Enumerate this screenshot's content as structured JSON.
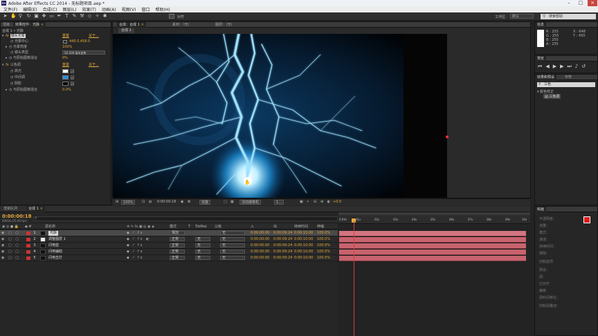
{
  "title_bar": {
    "app": "Adobe After Effects CC 2014 - 无标题项目.aep *"
  },
  "menu": [
    "文件(F)",
    "编辑(E)",
    "合成(C)",
    "图层(L)",
    "效果(T)",
    "动画(A)",
    "视图(V)",
    "窗口",
    "帮助(H)"
  ],
  "toolbar": {
    "align_label": "对齐",
    "workspace_label": "工作区:",
    "workspace_value": "默认",
    "search_placeholder": "搜索帮助"
  },
  "project_panel": {
    "tab_project": "项目",
    "tab_effects": "效果控件：光脉",
    "breadcrumb": "合成 1 • 光脉"
  },
  "effect_controls": {
    "rows": [
      {
        "label": "镜头光晕",
        "fx": "fx",
        "reset": "重置",
        "about": "关于..."
      },
      {
        "label": "光晕中心",
        "value": "440.0,458.0"
      },
      {
        "label": "光晕亮度",
        "value": "100%"
      },
      {
        "label": "镜头类型",
        "select": "50-300 毫米变焦"
      },
      {
        "label": "与原始图像混合",
        "value": "0%"
      },
      {
        "label": "三色调",
        "fx": "fx",
        "reset": "重置",
        "about": "关于..."
      },
      {
        "label": "高光"
      },
      {
        "label": "中间调"
      },
      {
        "label": "阴影"
      },
      {
        "label": "与原始图像混合",
        "value": "0.0%"
      }
    ]
  },
  "comp_viewer": {
    "tab_comp": "合成：合成 1",
    "tab_footage": "素材：（无）",
    "tab_layer": "图层：（无）",
    "comp_tab_label": "合成 1"
  },
  "viewer_bottom": {
    "zoom": "100%",
    "timecode": "0:00:00:18",
    "resolution": "完整",
    "camera": "活动摄像机",
    "views": "1...",
    "exposure": "+0.0"
  },
  "info_panel": {
    "tab": "信息",
    "r": "R : 255",
    "g": "G : 255",
    "b": "B : 255",
    "a": "A : 255",
    "x": "X : 648",
    "y": "Y : 450"
  },
  "preview_panel": {
    "tab": "预览"
  },
  "effects_presets": {
    "tab": "效果和预设",
    "tab2": "字符",
    "search": "三色",
    "category": "颜色校正",
    "item": "三色调"
  },
  "timeline": {
    "tab_render": "渲染队列",
    "tab_comp": "合成 1",
    "timecode": "0:00:00:18",
    "fps": "00018 (25.00 fps)",
    "headers": {
      "name": "源名称",
      "mode": "模式",
      "t": "T",
      "trkmat": "TrkMat",
      "parent": "父级",
      "in": "入",
      "out": "出",
      "duration": "持续时间",
      "stretch": "伸缩"
    },
    "layers": [
      {
        "num": "1",
        "name": "光脉",
        "mode": "相加",
        "trk": "",
        "parent": "无",
        "in": "0:00:00:00",
        "out": "0:00:09:24",
        "dur": "0:00:10:00",
        "stretch": "100.0%"
      },
      {
        "num": "2",
        "name": "调整图层 1",
        "mode": "正常",
        "trk": "无",
        "parent": "无",
        "in": "0:00:00:00",
        "out": "0:00:09:24",
        "dur": "0:00:10:00",
        "stretch": "100.0%"
      },
      {
        "num": "3",
        "name": "闪电蓝",
        "mode": "正常",
        "trk": "无",
        "parent": "无",
        "in": "0:00:00:00",
        "out": "0:00:09:24",
        "dur": "0:00:10:00",
        "stretch": "100.0%"
      },
      {
        "num": "4",
        "name": "闪电辅助",
        "mode": "正常",
        "trk": "无",
        "parent": "无",
        "in": "0:00:00:00",
        "out": "0:00:09:24",
        "dur": "0:00:10:00",
        "stretch": "100.0%"
      },
      {
        "num": "5",
        "name": "闪电击打",
        "mode": "正常",
        "trk": "无",
        "parent": "无",
        "in": "0:00:00:00",
        "out": "0:00:09:24",
        "dur": "0:00:10:00",
        "stretch": "100.0%"
      }
    ],
    "ruler": [
      "0:00s",
      "01s",
      "02s",
      "03s",
      "04s",
      "05s",
      "06s",
      "07s",
      "08s",
      "09s",
      "10s"
    ]
  },
  "paint_panel": {
    "tab": "绘画",
    "props": [
      "不透明度：",
      "流量：",
      "模式：",
      "通道：",
      "持续时间：",
      "擦除：",
      "仿制选项",
      "预设：",
      "源：",
      "已对齐",
      "偏移",
      "源时间移位：",
      "仿制源叠加："
    ]
  },
  "colors": {
    "accent": "#e3a93a",
    "layer_label": "#cc3333",
    "track": "#c7636e",
    "swatch_fg": "#e11b1b"
  }
}
